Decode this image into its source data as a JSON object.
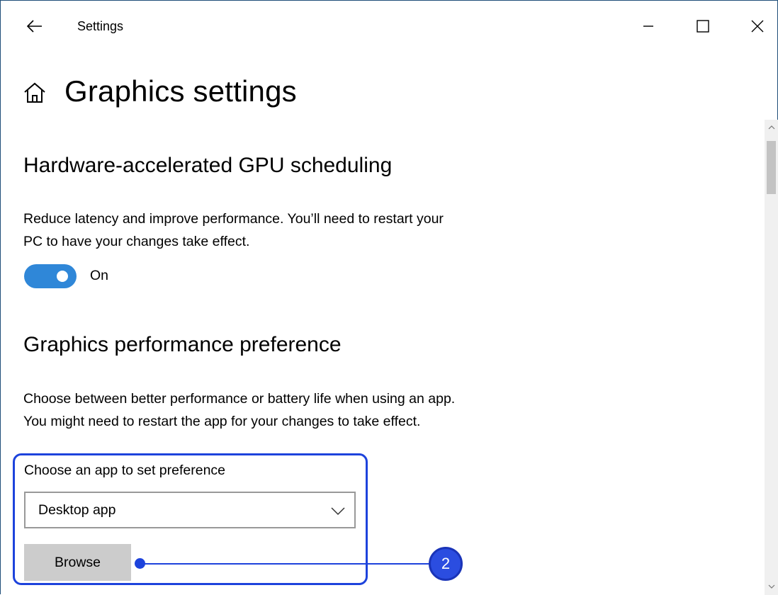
{
  "window": {
    "title": "Settings"
  },
  "icons": {
    "back": "back-arrow-icon",
    "minimize": "minimize-icon",
    "maximize": "maximize-icon",
    "close": "close-icon",
    "home": "home-icon",
    "chevron": "chevron-down-icon"
  },
  "page": {
    "title": "Graphics settings"
  },
  "gpu_scheduling": {
    "heading": "Hardware-accelerated GPU scheduling",
    "description_line1": "Reduce latency and improve performance. You’ll need to restart your",
    "description_line2": "PC to have your changes take effect.",
    "toggle_state": "On",
    "toggle_on": true
  },
  "performance_preference": {
    "heading": "Graphics performance preference",
    "description_line1": "Choose between better performance or battery life when using an app.",
    "description_line2": "You might need to restart the app for your changes to take effect.",
    "select_label": "Choose an app to set preference",
    "selected_value": "Desktop app",
    "browse_label": "Browse"
  },
  "callout": {
    "number": "2"
  },
  "colors": {
    "accent": "#2f87d8",
    "callout": "#1d43dc",
    "button_bg": "#cccccc"
  }
}
